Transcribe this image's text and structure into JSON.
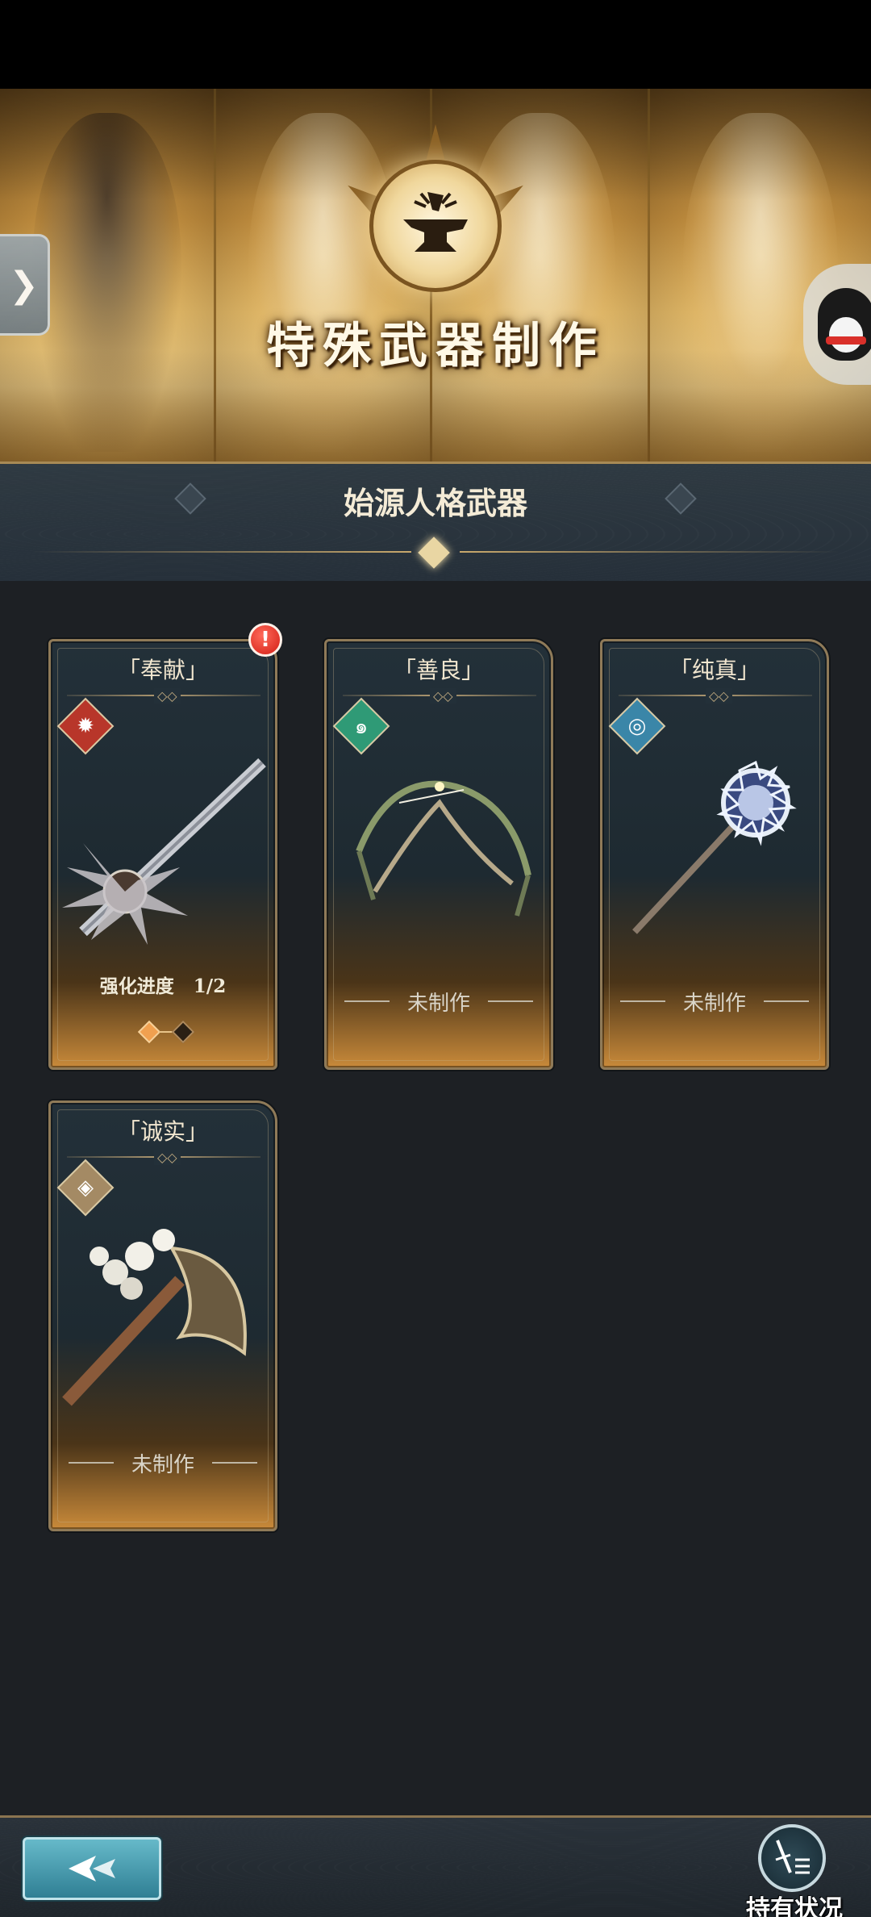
{
  "banner": {
    "title": "特殊武器制作",
    "side_tab_glyph": "❯"
  },
  "section": {
    "title": "始源人格武器"
  },
  "weapons": [
    {
      "name": "「奉献」",
      "element": "fire",
      "element_color": "#b8362a",
      "status": "",
      "progress_label": "强化进度",
      "progress_value": "1/2",
      "progress_fraction": 0.5,
      "has_alert": true,
      "alert_glyph": "!"
    },
    {
      "name": "「善良」",
      "element": "wind",
      "element_color": "#2f9a76",
      "status": "未制作",
      "has_alert": false
    },
    {
      "name": "「纯真」",
      "element": "water",
      "element_color": "#3a86a8",
      "status": "未制作",
      "has_alert": false
    },
    {
      "name": "「诚实」",
      "element": "earth",
      "element_color": "#a48a64",
      "status": "未制作",
      "has_alert": false
    }
  ],
  "card_rule_mark": "◇◇",
  "bottom_bar": {
    "possession_label": "持有状况"
  },
  "colors": {
    "gold_accent": "#c8a86c",
    "alert_red": "#d21d14",
    "back_button": "#2f7f94"
  }
}
